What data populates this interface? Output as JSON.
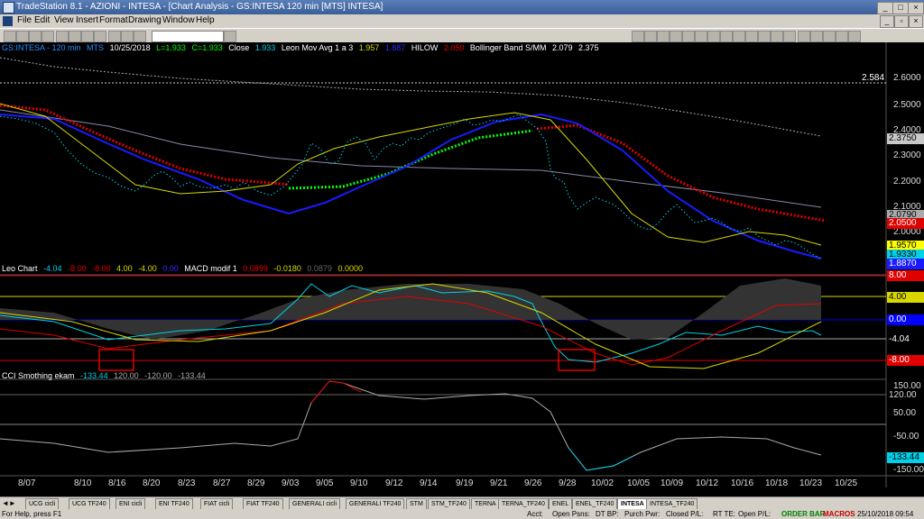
{
  "window": {
    "title": "TradeStation 8.1 - AZIONI - INTESA - [Chart Analysis - GS:INTESA  120 min  [MTS] INTESA]"
  },
  "menu": [
    "File",
    "Edit",
    "View",
    "Insert",
    "Format",
    "Drawing",
    "Window",
    "Help"
  ],
  "price_panel": {
    "legend": {
      "symbol": "GS:INTESA - 120 min",
      "mts": "MTS",
      "date": "10/25/2018",
      "low": "L=1.933",
      "close": "C=1.933",
      "close_label": "Close",
      "close_val": "1.933",
      "mov_avg": "Leon Mov Avg 1 a 3",
      "mov_val1": "1.957",
      "mov_val2": "1.887",
      "hilow": "HILOW",
      "hilow_val": "2.050",
      "bb": "Bollinger Band S/MM",
      "bb_val1": "2.079",
      "bb_val2": "2.375"
    },
    "line_value": "2.584",
    "ticks": [
      "2.6000",
      "2.5000",
      "2.4000",
      "2.3000",
      "2.2000",
      "2.1000",
      "2.0000"
    ],
    "labels": {
      "bb_upper": "2.3750",
      "bb_lower": "2.0790",
      "hilow": "2.0500",
      "movavg": "1.9570",
      "close": "1.9330",
      "movavg2": "1.8870"
    }
  },
  "leo_panel": {
    "legend": {
      "name": "Leo Chart",
      "v1": "-4.04",
      "v2": "-8.00",
      "v3": "-8.00",
      "v4": "4.00",
      "v5": "-4.00",
      "v6": "0.00",
      "macd": "MACD modif 1",
      "m1": "0.0899",
      "m2": "-0.0180",
      "m3": "0.0879",
      "m4": "0.0000"
    },
    "labels": {
      "l8": "8.00",
      "l4": "4.00",
      "l0": "0.00",
      "lm4": "-4.04",
      "lm8": "-8.00"
    }
  },
  "cci_panel": {
    "legend": {
      "name": "CCI Smothing ekam",
      "v1": "-133.44",
      "v2": "120.00",
      "v3": "-120.00",
      "v4": "-133.44"
    },
    "ticks": [
      "150.00",
      "50.00",
      "-50.00",
      "-150.00"
    ],
    "labels": {
      "l120": "120.00",
      "lcci": "-133.44"
    }
  },
  "x_axis": [
    "8/07",
    "8/10",
    "8/16",
    "8/20",
    "8/23",
    "8/27",
    "8/29",
    "9/03",
    "9/05",
    "9/10",
    "9/12",
    "9/14",
    "9/19",
    "9/21",
    "9/26",
    "9/28",
    "10/02",
    "10/05",
    "10/09",
    "10/12",
    "10/16",
    "10/18",
    "10/23",
    "10/25"
  ],
  "tabs": [
    "UCG cicli",
    "UCG TF240",
    "ENI cicli",
    "ENI TF240",
    "FIAT cicli",
    "FIAT TF240",
    "GENERALI cicli",
    "GENERALI TF240",
    "STM",
    "STM_TF240",
    "TERNA",
    "TERNA_TF240",
    "ENEL",
    "ENEL_TF240",
    "INTESA",
    "INTESA_TF240"
  ],
  "active_tab": "INTESA",
  "status": {
    "help": "For Help, press F1",
    "acct": "Acct:",
    "open_psns": "Open Psns:",
    "dt_bp": "DT BP:",
    "purch_pwr": "Purch Pwr:",
    "closed_pl": "Closed P/L:",
    "rt_te": "RT TE:",
    "open_pl": "Open P/L:",
    "order_bar": "ORDER BAR",
    "macros": "MACROS",
    "datetime": "25/10/2018 09:54"
  },
  "colors": {
    "price_dots": "#00d0e8",
    "bb_red": "#e00000",
    "ma_blue": "#1a1aff",
    "ma_yellow": "#d8d800",
    "ma_green": "#00ff00",
    "zero_line": "#0000ff",
    "panel_line": "#e00000",
    "order_bar": "#008000",
    "macros": "#c00000"
  }
}
